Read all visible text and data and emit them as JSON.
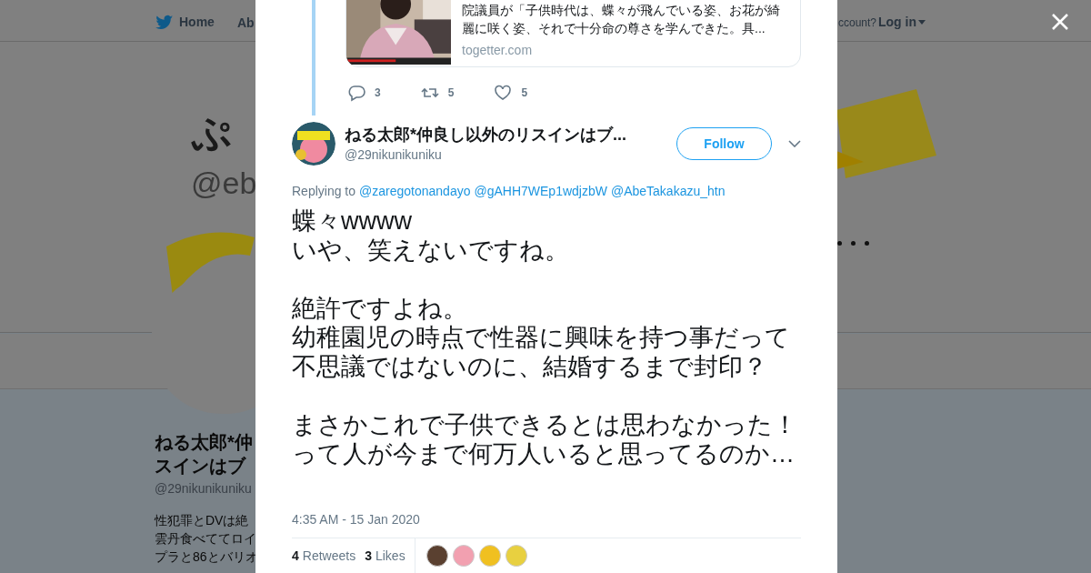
{
  "background_page": {
    "nav": {
      "home": "Home",
      "about": "Ab",
      "account": "ccount?",
      "login": "Log in"
    },
    "banner_name": "ぷ",
    "banner_handle": "@eb",
    "profile": {
      "name_lines": [
        "ねる太郎*仲",
        "スインはブ"
      ],
      "handle": "@29nikunikuniku",
      "bio_lines": [
        "性犯罪とDVは絶",
        "雲丹食べててロイ",
        "プラと86とバリオ"
      ]
    }
  },
  "modal": {
    "quoted_card": {
      "text": "院議員が「子供時代は、蝶々が飛んでいる姿、お花が綺麗に咲く姿、それで十分命の尊さを学んできた。具...",
      "domain": "togetter.com"
    },
    "parent_actions": [
      {
        "kind": "reply",
        "count": "3"
      },
      {
        "kind": "retweet",
        "count": "5"
      },
      {
        "kind": "like",
        "count": "5"
      }
    ],
    "tweet": {
      "name": "ねる太郎*仲良し以外のリスインはブ...",
      "handle": "@29nikunikuniku",
      "follow_label": "Follow",
      "replying_prefix": "Replying to",
      "replying_to": [
        "@zaregotonandayo",
        "@gAHH7WEp1wdjzbW",
        "@AbeTakakazu_htn"
      ],
      "paragraphs": [
        [
          "蝶々wwww",
          "いや、笑えないですね。"
        ],
        [
          "絶許ですよね。",
          "幼稚園児の時点で性器に興味を持つ事だって",
          "不思議ではないのに、結婚するまで封印？"
        ],
        [
          "まさかこれで子供できるとは思わなかった！って人が今まで何万人いると思ってるのか…"
        ]
      ],
      "timestamp": "4:35 AM - 15 Jan 2020",
      "stats": [
        {
          "count": "4",
          "label": "Retweets"
        },
        {
          "count": "3",
          "label": "Likes"
        }
      ],
      "likers": [
        {
          "color": "#5a4030"
        },
        {
          "color": "#f2a0b0"
        },
        {
          "color": "#f0c020"
        },
        {
          "color": "#e8d040"
        }
      ]
    }
  }
}
